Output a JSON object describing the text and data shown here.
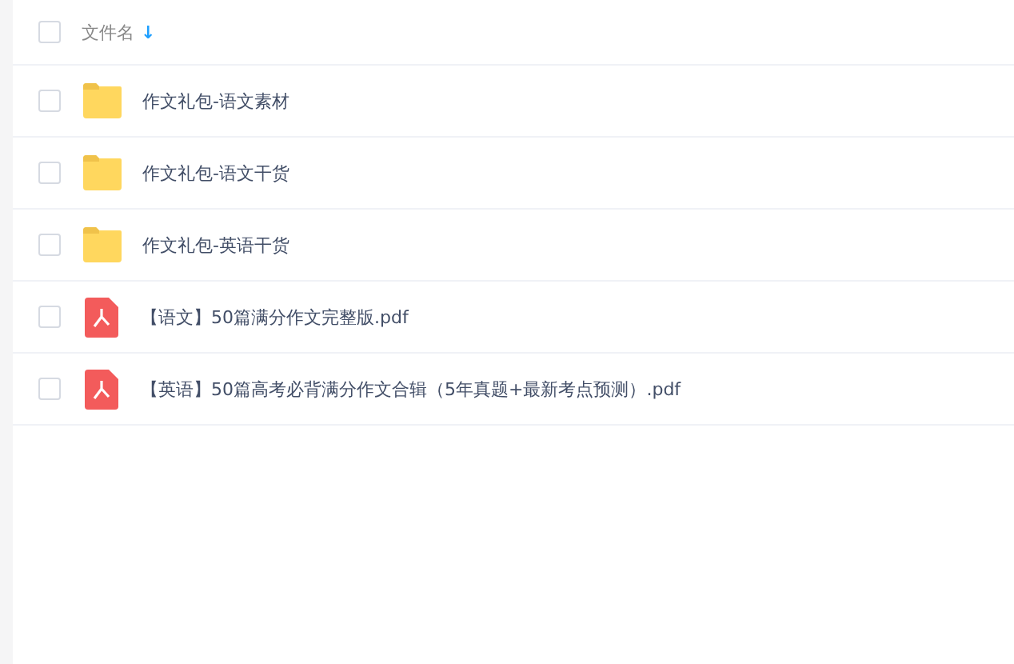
{
  "header": {
    "checked": false,
    "column": "文件名",
    "sort_icon": "↓"
  },
  "files": [
    {
      "kind": "folder",
      "name": "作文礼包-语文素材",
      "checked": false
    },
    {
      "kind": "folder",
      "name": "作文礼包-语文干货",
      "checked": false
    },
    {
      "kind": "folder",
      "name": "作文礼包-英语干货",
      "checked": false
    },
    {
      "kind": "pdf",
      "name": "【语文】50篇满分作文完整版.pdf",
      "checked": false
    },
    {
      "kind": "pdf",
      "name": "【英语】50篇高考必背满分作文合辑（5年真题+最新考点预测）.pdf",
      "checked": false
    }
  ]
}
